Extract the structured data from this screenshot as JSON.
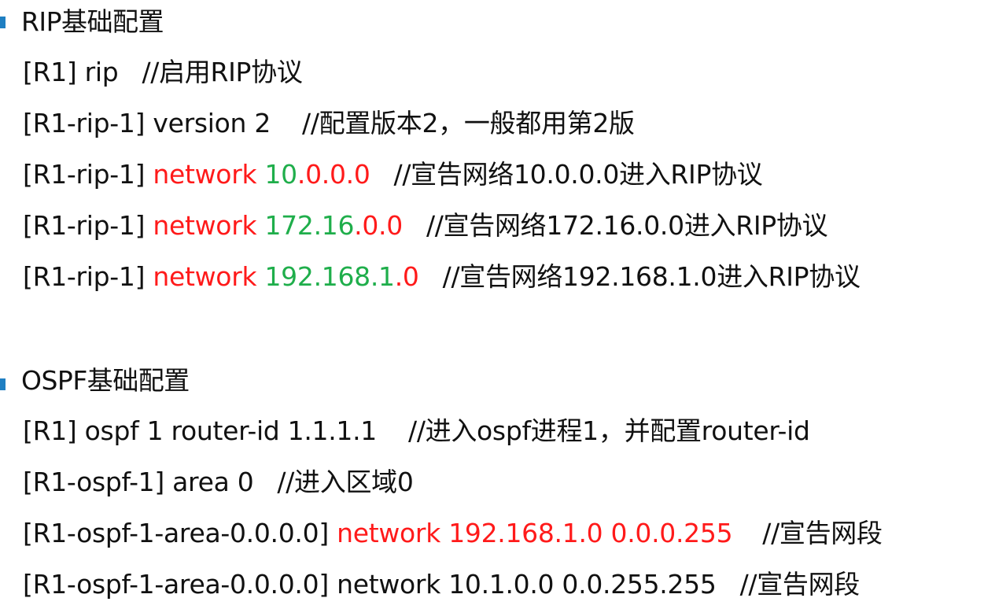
{
  "rip": {
    "heading": "RIP基础配置",
    "lines": [
      {
        "prompt": "[R1] rip",
        "comment": "//启用RIP协议"
      },
      {
        "prompt": "[R1-rip-1] version 2",
        "comment": "//配置版本2，一般都用第2版"
      },
      {
        "prompt": "[R1-rip-1] ",
        "keyword": "network",
        "addr_green": "10",
        "addr_red": ".0.0.0",
        "comment": "//宣告网络10.0.0.0进入RIP协议"
      },
      {
        "prompt": "[R1-rip-1] ",
        "keyword": "network",
        "addr_green": "172.16",
        "addr_red": ".0.0",
        "comment": "//宣告网络172.16.0.0进入RIP协议"
      },
      {
        "prompt": "[R1-rip-1] ",
        "keyword": "network",
        "addr_green": "192.168.1",
        "addr_red": ".0",
        "comment": "//宣告网络192.168.1.0进入RIP协议"
      }
    ]
  },
  "ospf": {
    "heading": "OSPF基础配置",
    "lines": [
      {
        "prompt": "[R1] ospf 1 router-id 1.1.1.1",
        "comment": "//进入ospf进程1，并配置router-id"
      },
      {
        "prompt": "[R1-ospf-1] area 0",
        "comment": "//进入区域0"
      },
      {
        "prompt": "[R1-ospf-1-area-0.0.0.0] ",
        "red_text": "network 192.168.1.0 0.0.0.255",
        "comment": "//宣告网段"
      },
      {
        "prompt": "[R1-ospf-1-area-0.0.0.0] network 10.1.0.0 0.0.255.255",
        "comment": "//宣告网段"
      }
    ]
  },
  "colors": {
    "bullet": "#1f7fc2",
    "keyword": "#ff1a1a",
    "address": "#1fae4b"
  }
}
